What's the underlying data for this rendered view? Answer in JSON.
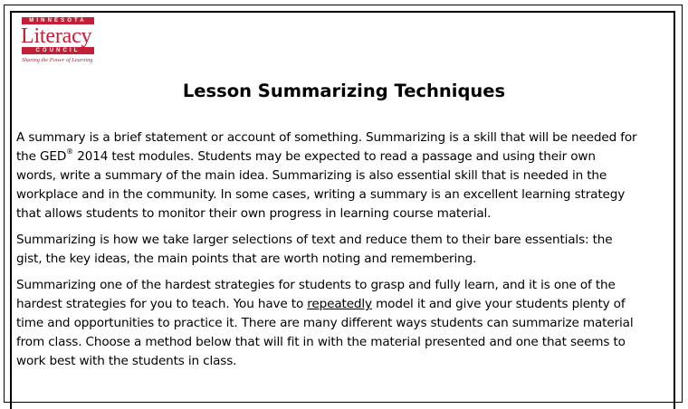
{
  "logo": {
    "top_band": "MINNESOTA",
    "word": "Literacy",
    "bottom_band": "COUNCIL",
    "tagline": "Sharing the Power of Learning"
  },
  "title": "Lesson Summarizing Techniques",
  "p1": {
    "l1": "A summary is a brief statement or account of something. Summarizing is a skill that will be needed for",
    "l2a": "the GED",
    "l2sup": "®",
    "l2b": "2014 test modules. Students may be expected to read a passage and using their own",
    "l3": "words, write a summary of the main idea. Summarizing is also essential skill that is needed in the",
    "l4": "workplace and in the community.  In some cases, writing a summary is an excellent learning strategy",
    "l5": "that allows students to monitor their own progress in learning course material."
  },
  "p2": {
    "l1": "Summarizing is how we take larger selections of text and reduce them to their bare essentials: the",
    "l2": "gist, the key ideas, the main points that are worth noting and remembering."
  },
  "p3": {
    "l1": "Summarizing one of the hardest strategies for students to grasp and fully learn, and it is one of the",
    "l2a": "hardest strategies for you to teach. You have to ",
    "l2u": "repeatedly",
    "l2b": " model it and give your students plenty of",
    "l3": "time and opportunities to practice it. There are many different ways students can summarize material",
    "l4": "from class.  Choose a method below that will fit in with the material presented and one that seems to",
    "l5": "work best with the students in class."
  }
}
